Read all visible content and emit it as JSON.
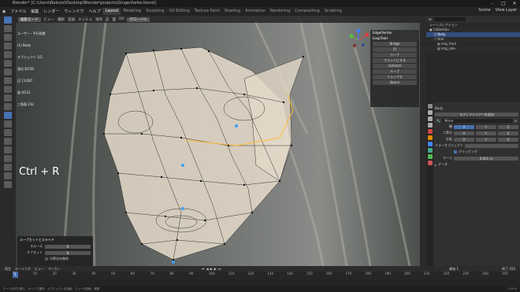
{
  "titlebar": {
    "title": "Blender* [C:\\Users\\Bakumi\\Desktop\\Blender\\projects\\Gingenfarbe.blend]",
    "controls": [
      "–",
      "□",
      "✕"
    ]
  },
  "menubar": {
    "menus": [
      "ファイル",
      "編集",
      "レンダー",
      "ウィンドウ",
      "ヘルプ"
    ],
    "workspaces": [
      "Layout",
      "Modeling",
      "Sculpting",
      "UV Editing",
      "Texture Paint",
      "Shading",
      "Animation",
      "Rendering",
      "Compositing",
      "Scripting"
    ],
    "active_workspace": "Layout",
    "scene": "Scene",
    "view_layer": "View Layer"
  },
  "viewport": {
    "header_items": [
      "編集モード",
      "ビュー",
      "選択",
      "追加",
      "メッシュ",
      "頂点",
      "辺",
      "面",
      "UV"
    ],
    "global_label": "グローバル",
    "stats": [
      "ユーザー・平行投影",
      "(1) Body",
      "オブジェクト 1/1",
      "頂点 8/158",
      "辺 11/287",
      "面 0/131",
      "三角面 232"
    ],
    "key_hint": "Ctrl + R",
    "loop_panel": {
      "title1": "Edge/Vertex",
      "title2": "LoopTools",
      "items": [
        "Bridge",
        "円",
        "カーブ",
        "フラットにする",
        "Gstretch",
        "ループ",
        "リラックス",
        "Space"
      ]
    }
  },
  "operator_panel": {
    "title": "ループカットとスライド",
    "rows": [
      {
        "label": "スムーズ",
        "value": "0"
      },
      {
        "label": "オフセット",
        "value": "0"
      }
    ],
    "checkbox": "均等化を無効"
  },
  "outliner": {
    "header": "シーンコレクション",
    "rows": [
      "Collection",
      "Body",
      "Hair",
      "img_front",
      "img_side"
    ],
    "selected": "Body"
  },
  "properties": {
    "object": "Body",
    "section": "モディファイアーを追加",
    "modifier": "Mirror",
    "rows": [
      {
        "label": "軸",
        "values": [
          "X",
          "Y",
          "Z"
        ]
      },
      {
        "label": "二等分",
        "values": [
          "X",
          "Y",
          "Z"
        ]
      },
      {
        "label": "反転",
        "values": [
          "X",
          "Y",
          "Z"
        ]
      }
    ],
    "mirror_object": "ミラーオブジェクト",
    "clipping": "クリッピング",
    "merge": "マージ",
    "merge_value": "0.001 m",
    "data": "データ"
  },
  "timeline": {
    "menu": [
      "再生",
      "キーイング",
      "ビュー",
      "マーカー"
    ],
    "current_frame": "1",
    "ticks": [
      "0",
      "10",
      "20",
      "30",
      "40",
      "50",
      "60",
      "70",
      "80",
      "90",
      "100",
      "110",
      "120",
      "130",
      "140",
      "150",
      "160",
      "170",
      "180",
      "190",
      "200",
      "210",
      "220",
      "230",
      "240",
      "250"
    ],
    "start": "開始 1",
    "end": "終了 250"
  },
  "status": {
    "text": "モードを切り替え、ボックス選択、オブジェクトを回転、ビューの回転、移動",
    "version": "2.90.0"
  },
  "colors": {
    "accent": "#4772b3",
    "mesh_fill": "#e8dccb",
    "vertex": "#111111",
    "selected": "#ff8a00"
  }
}
